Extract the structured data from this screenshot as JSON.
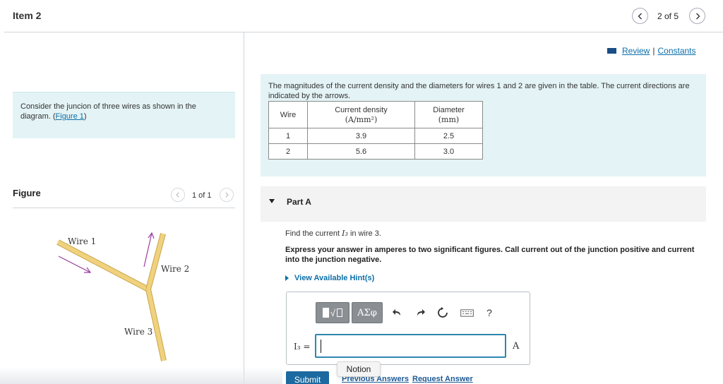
{
  "header": {
    "item_title": "Item 2",
    "page_count": "2 of 5"
  },
  "intro": {
    "text": "Consider the juncion of three wires as shown in the diagram. (",
    "figure_link": "Figure 1",
    "close_paren": ")"
  },
  "figure": {
    "title": "Figure",
    "count": "1 of 1",
    "labels": {
      "wire1": "Wire 1",
      "wire2": "Wire 2",
      "wire3": "Wire 3"
    },
    "wire_color": "#e8c76a",
    "arrow_color": "#9b3ea0"
  },
  "links": {
    "review": "Review",
    "separator": "|",
    "constants": "Constants"
  },
  "problem": {
    "intro": "The magnitudes of the current density and the diameters for wires 1 and 2 are given in the table. The current directions are indicated by the arrows.",
    "table": {
      "headers": {
        "wire": "Wire",
        "density": "Current density",
        "density_unit": "(A/mm²)",
        "diameter": "Diameter",
        "diameter_unit": "(mm)"
      },
      "rows": [
        {
          "wire": "1",
          "density": "3.9",
          "diameter": "2.5"
        },
        {
          "wire": "2",
          "density": "5.6",
          "diameter": "3.0"
        }
      ]
    }
  },
  "part_a": {
    "label": "Part A",
    "question_prefix": "Find the current",
    "question_var": "I₃",
    "question_suffix": "in wire 3.",
    "instructions": "Express your answer in amperes to two significant figures. Call current out of the junction positive and current into the junction negative.",
    "hints": "View Available Hint(s)",
    "answer_label": "I₃ =",
    "answer_value": "",
    "unit": "A",
    "toolbar": {
      "greek": "ΑΣφ",
      "help": "?"
    },
    "submit": "Submit",
    "previous_answers": "Previous Answers",
    "request_answer": "Request Answer"
  },
  "tooltip": {
    "text": "Notion"
  }
}
